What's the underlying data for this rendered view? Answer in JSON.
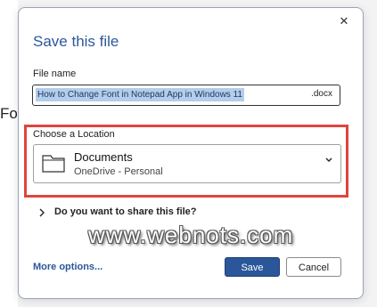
{
  "background": {
    "doc_text_fragment": "Fo"
  },
  "dialog": {
    "title": "Save this file",
    "close_glyph": "✕",
    "file_name": {
      "label": "File name",
      "value": "How to Change Font in Notepad App in Windows 11",
      "extension": ".docx"
    },
    "location": {
      "label": "Choose a Location",
      "selected_name": "Documents",
      "selected_sub": "OneDrive - Personal",
      "icon": "folder-icon"
    },
    "share": {
      "label": "Do you want to share this file?"
    },
    "watermark": "www.webnots.com",
    "more_options": "More options...",
    "save_label": "Save",
    "cancel_label": "Cancel"
  },
  "colors": {
    "accent": "#2b579a",
    "highlight": "#e0443e",
    "selection": "#b3cdea"
  }
}
